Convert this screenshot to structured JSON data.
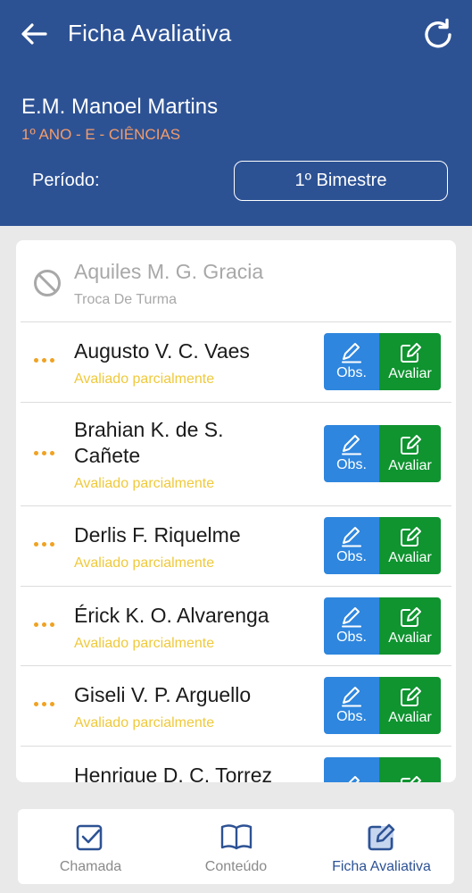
{
  "header": {
    "title": "Ficha Avaliativa",
    "school": "E.M. Manoel Martins",
    "class_info": "1º ANO - E - CIÊNCIAS",
    "period_label": "Período:",
    "period_value": "1º Bimestre"
  },
  "students": [
    {
      "name": "Aquiles M. G. Gracia",
      "status": "Troca De Turma",
      "disabled": true
    },
    {
      "name": "Augusto V. C. Vaes",
      "status": "Avaliado parcialmente"
    },
    {
      "name": "Brahian K. de S. Cañete",
      "status": "Avaliado parcialmente"
    },
    {
      "name": "Derlis F. Riquelme",
      "status": "Avaliado parcialmente"
    },
    {
      "name": "Érick K. O. Alvarenga",
      "status": "Avaliado parcialmente"
    },
    {
      "name": "Giseli V. P. Arguello",
      "status": "Avaliado parcialmente"
    },
    {
      "name": "Henrique D. C. Torrez",
      "status": ""
    }
  ],
  "buttons": {
    "obs_label": "Obs.",
    "avaliar_label": "Avaliar"
  },
  "nav": {
    "items": [
      {
        "label": "Chamada",
        "icon": "checkbox-icon"
      },
      {
        "label": "Conteúdo",
        "icon": "book-icon"
      },
      {
        "label": "Ficha Avaliativa",
        "icon": "edit-icon",
        "active": true
      }
    ]
  },
  "colors": {
    "header_bg": "#2d5294",
    "accent_orange": "#f39c6b",
    "status_yellow": "#efc93b",
    "obs_blue": "#2e86de",
    "avaliar_green": "#0f9430",
    "dots_orange": "#f0a223"
  }
}
